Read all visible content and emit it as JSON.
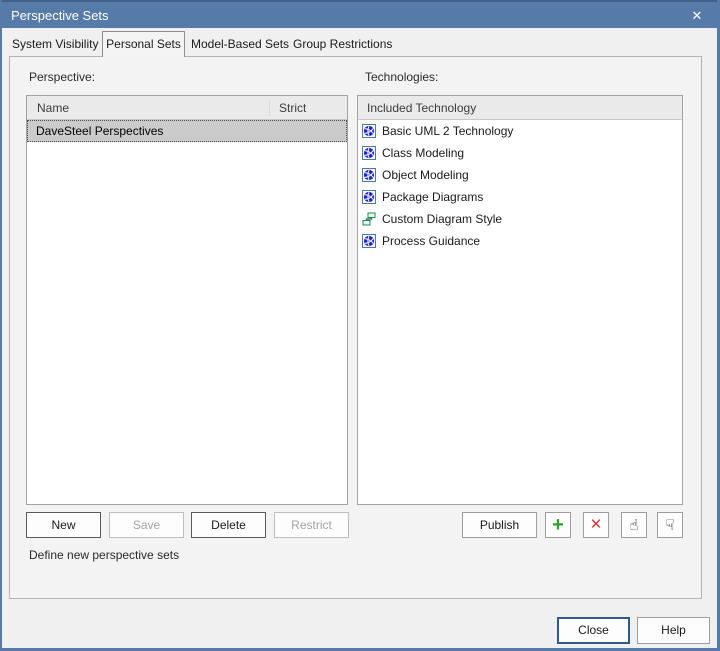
{
  "window": {
    "title": "Perspective Sets",
    "close_glyph": "✕"
  },
  "tabs": [
    {
      "label": "System Visibility",
      "active": false
    },
    {
      "label": "Personal Sets",
      "active": true
    },
    {
      "label": "Model-Based Sets",
      "active": false
    },
    {
      "label": "Group Restrictions",
      "active": false
    }
  ],
  "left_panel": {
    "label": "Perspective:",
    "columns": {
      "name": "Name",
      "strict": "Strict"
    },
    "rows": [
      {
        "name": "DaveSteel Perspectives",
        "strict": "",
        "selected": true
      }
    ],
    "buttons": [
      {
        "label": "New",
        "enabled": true
      },
      {
        "label": "Save",
        "enabled": false
      },
      {
        "label": "Delete",
        "enabled": true
      },
      {
        "label": "Restrict",
        "enabled": false
      }
    ],
    "hint": "Define new perspective sets"
  },
  "right_panel": {
    "label": "Technologies:",
    "column": "Included Technology",
    "items": [
      {
        "label": "Basic UML 2 Technology",
        "icon": "mdg-technology-icon"
      },
      {
        "label": "Class Modeling",
        "icon": "mdg-technology-icon"
      },
      {
        "label": "Object Modeling",
        "icon": "mdg-technology-icon"
      },
      {
        "label": "Package Diagrams",
        "icon": "mdg-technology-icon"
      },
      {
        "label": "Custom Diagram Style",
        "icon": "diagram-style-icon"
      },
      {
        "label": "Process Guidance",
        "icon": "mdg-technology-icon"
      }
    ],
    "publish_label": "Publish",
    "icon_buttons": [
      {
        "name": "add-button",
        "glyph": "+"
      },
      {
        "name": "remove-button",
        "glyph": "✕"
      },
      {
        "name": "hand-up-button",
        "glyph": "☝"
      },
      {
        "name": "hand-down-button",
        "glyph": "☟"
      }
    ]
  },
  "footer": {
    "close_label": "Close",
    "help_label": "Help"
  },
  "colors": {
    "titlebar": "#567ba8",
    "dialog_border": "#567ba8",
    "selection_bg": "#cbcbcb",
    "add_green": "#2e9e2e",
    "remove_red": "#d43c3c",
    "default_button_border": "#2b5c8a"
  }
}
